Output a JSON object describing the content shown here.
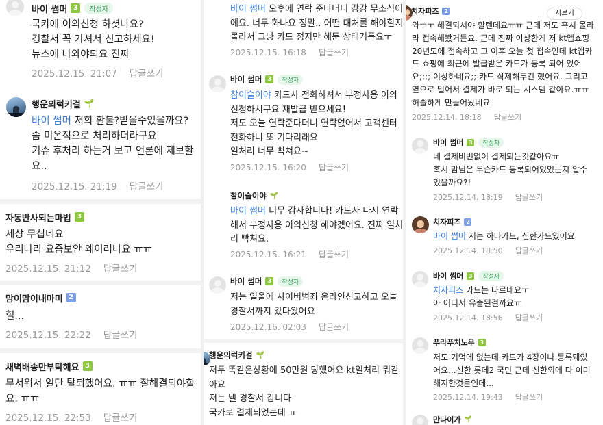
{
  "col1": [
    {
      "name": "바이 썸머",
      "level": "3",
      "level_color": "green",
      "author_badge": "작성자",
      "lines": [
        "국카에 이의신청 하셧나요?",
        "경찰서 꼭 가셔서 신고하세요!",
        "뉴스에 나와야되요 진짜"
      ],
      "date": "2025.12.15. 21:07",
      "reply": "답글쓰기"
    },
    {
      "name": "행운의럭키걸",
      "sprout": "🌱",
      "mention": "바이 썸머",
      "lines": [
        "저희 환불?받을수있을까요?",
        "좀 미온적으로 처리하더라구요",
        "기슈 후처리 하는거 보고 언론에 제보할",
        "요.."
      ],
      "date": "2025.12.15. 21:19",
      "reply": "답글쓰기"
    },
    {
      "name": "자동반사되는마법",
      "level": "3",
      "level_color": "green",
      "lines": [
        "세상 무섭네요",
        "우리나라 요즘보안 왜이러나요 ㅠㅠ"
      ],
      "date": "2025.12.15. 21:12",
      "reply": "답글쓰기"
    },
    {
      "name": "맘이맘이내마미",
      "level": "2",
      "level_color": "blue",
      "lines": [
        "헐..."
      ],
      "date": "2025.12.15. 22:22",
      "reply": "답글쓰기"
    },
    {
      "name": "새벽배송만부탁해요",
      "level": "3",
      "level_color": "green",
      "lines": [
        "무서워서 일단 탈퇴했어요. ㅠㅠ 잘해결되야할",
        "요. ㅠㅠ"
      ],
      "date": "2025.12.15. 22:53",
      "reply": "답글쓰기"
    }
  ],
  "col2": [
    {
      "mention": "바이 썸머",
      "lines": [
        "오후에 연락 준다더니 감감 무소식이",
        "에요. 너무 화나요 정말.. 어떤 대처를 해야할지",
        "몰라서 그냥 카드 정지만 해둔 상태거든요ㅜ"
      ],
      "date": "2025.12.15. 16:18",
      "reply": "답글쓰기"
    },
    {
      "name": "바이 썸머",
      "level": "3",
      "level_color": "green",
      "author_badge": "작성자",
      "mention": "참이슬이야",
      "lines": [
        "카드사 전화하셔서 부정사용 이의",
        "신청하시구요 재발급 받으세요!",
        "저도 오늘 연락준다더니 연락없어서 고객센터",
        "전화하니 또 기다리래요",
        "일처리 너무 빡쳐요~"
      ],
      "date": "2025.12.15. 16:20",
      "reply": "답글쓰기"
    },
    {
      "name": "참이슬이야",
      "sprout": "🌱",
      "mention": "바이 썸머",
      "lines": [
        "너무 감사합니다! 카드사 다시 연락",
        "해서 부정사용 이의신청 해야겠어요. 진짜 일처",
        "리 빡쳐요."
      ],
      "date": "2025.12.15. 16:21",
      "reply": "답글쓰기"
    },
    {
      "name": "바이 썸머",
      "level": "3",
      "level_color": "green",
      "author_badge": "작성자",
      "lines": [
        "저는 일올에 사이버범죄 온라인신고하고 오늘",
        "경찰서까지 갔다왔어요"
      ],
      "date": "2025.12.16. 02:03",
      "reply": "답글쓰기"
    },
    {
      "name": "행운의럭키걸",
      "sprout": "🌱",
      "lines": [
        "저두 똑같은상황에 50만원 당했어요 kt일처리 뭐같",
        "아요",
        "저는 낼 경찰서 갑니다",
        "국카로 결제되었는데 ㅠ"
      ]
    }
  ],
  "col3": [
    {
      "name": "치자피즈",
      "level": "2",
      "level_color": "blue",
      "cut_label": "자르기",
      "lines": [
        "와ㅜㅜ 해결되셔야 할텐데요ㅠㅠ 근데 저도 혹시 몰라",
        "라 접속해봤거든요. 근데 진짜 이상한게 저 kt앱쇼핑",
        "20년도에 접속하고 그 이후 오늘 첫 접속인데 kt앱카",
        "드 쇼핑에 최근에 발급받은 카드가 등록 되어 있어",
        "요;;;; 이상하네요;; 카드 삭제해두긴 했어요. 그리고",
        "옆으로 밀어서 결제가 바로 되는 시스템 같아요.ㅠㅠ",
        "허술하게 만들어놨네요"
      ],
      "date": "2025.12.14. 18:18",
      "reply": "답글쓰기"
    },
    {
      "name": "바이 썸머",
      "level": "3",
      "level_color": "green",
      "author_badge": "작성자",
      "lines": [
        "네 결제비번없이 결제되는것같아요ㅠ",
        "혹시 맘님은 무슨카드 등록되어있었는지 알수",
        "있을까요?!"
      ],
      "date": "2025.12.14. 18:19",
      "reply": "답글쓰기"
    },
    {
      "name": "치자피즈",
      "level": "2",
      "level_color": "blue",
      "mention": "바이 썸머",
      "lines": [
        "저는 하나카드, 신한카드였어요"
      ],
      "date": "2025.12.14. 18:50",
      "reply": "답글쓰기"
    },
    {
      "name": "바이 썸머",
      "level": "3",
      "level_color": "green",
      "author_badge": "작성자",
      "mention": "치자피즈",
      "lines": [
        "카드는 다르네요ㅜ",
        "아 어디서 유출된걸까요ㅠ"
      ],
      "date": "2025.12.14. 18:56",
      "reply": "답글쓰기"
    },
    {
      "name": "푸라푸치노우",
      "level": "3",
      "level_color": "green",
      "lines": [
        "저도 기억에 없는데 카드가 4장이나 등록돼있",
        "어요...신한 롯데2 국민 근데 신한외에 다 이미",
        "해지한것들인데..."
      ],
      "date": "2025.12.14. 19:43",
      "reply": "답글쓰기"
    },
    {
      "name": "만나이가",
      "sprout": "🌱"
    }
  ]
}
